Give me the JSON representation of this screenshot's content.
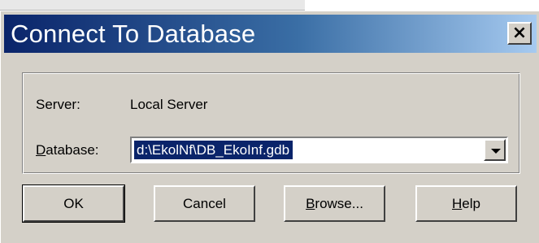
{
  "window": {
    "title": "Connect To Database",
    "close_glyph": "×"
  },
  "form": {
    "server_label": "Server:",
    "server_value": "Local Server",
    "database_label_mnemonic": "D",
    "database_label_rest": "atabase:",
    "database_value": "d:\\EkolNf\\DB_EkoInf.gdb"
  },
  "buttons": {
    "ok": "OK",
    "cancel": "Cancel",
    "browse_mnemonic": "B",
    "browse_rest": "rowse...",
    "help_mnemonic": "H",
    "help_rest": "elp"
  },
  "icons": {
    "close": "close-icon",
    "dropdown": "chevron-down-icon"
  },
  "colors": {
    "dialog_face": "#d4d0c8",
    "title_gradient_start": "#0a246a",
    "title_gradient_end": "#a6caf0",
    "selection": "#0a246a"
  }
}
